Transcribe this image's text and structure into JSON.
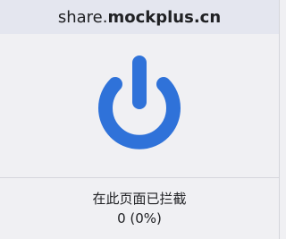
{
  "header": {
    "domain_prefix": "share.",
    "domain_host": "mockplus.cn"
  },
  "power_icon": {
    "name": "power-icon",
    "color": "#2f72d9"
  },
  "status": {
    "label": "在此页面已拦截",
    "count": "0 (0%)"
  }
}
